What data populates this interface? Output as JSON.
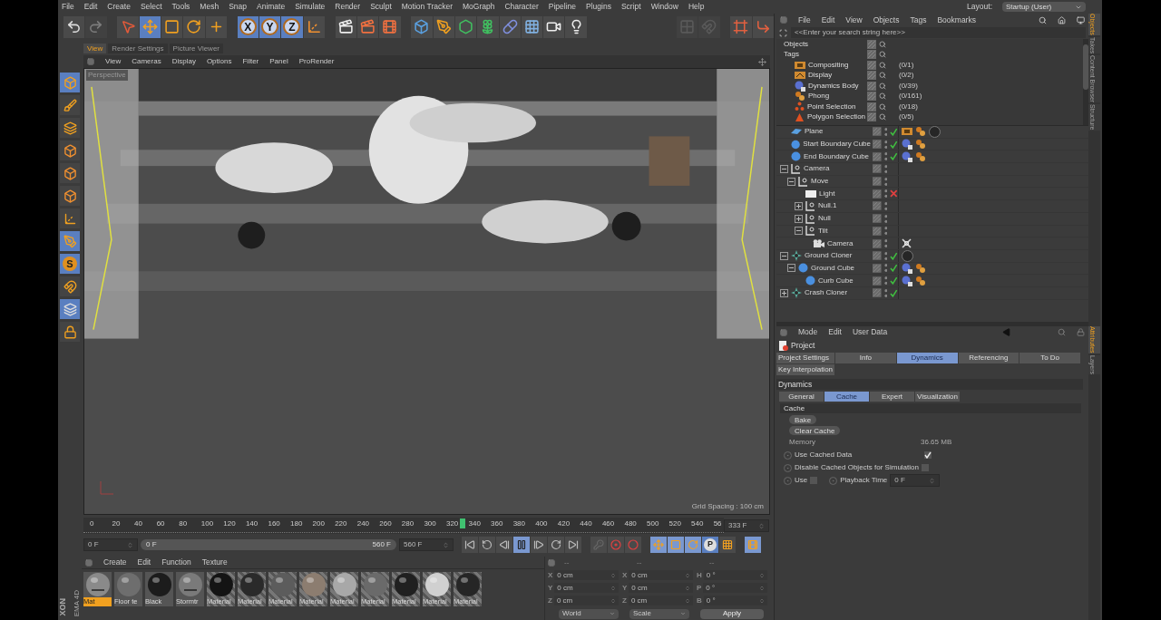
{
  "menu_bar": {
    "items": [
      "File",
      "Edit",
      "Create",
      "Select",
      "Tools",
      "Mesh",
      "Snap",
      "Animate",
      "Simulate",
      "Render",
      "Sculpt",
      "Motion Tracker",
      "MoGraph",
      "Character",
      "Pipeline",
      "Plugins",
      "Script",
      "Window",
      "Help"
    ],
    "layout_label": "Layout:",
    "layout_value": "Startup (User)"
  },
  "toolbar": [
    {
      "kind": "undo",
      "selected": false,
      "disabled": false
    },
    {
      "kind": "redo",
      "selected": false,
      "disabled": true
    },
    {
      "kind": "live-select",
      "selected": false,
      "disabled": false
    },
    {
      "kind": "move",
      "selected": true,
      "disabled": false
    },
    {
      "kind": "scale",
      "selected": false,
      "disabled": false
    },
    {
      "kind": "rotate",
      "selected": false,
      "disabled": false
    },
    {
      "kind": "add",
      "selected": false,
      "disabled": false
    },
    {
      "kind": "axis",
      "label": "X",
      "selected": true,
      "disabled": false
    },
    {
      "kind": "axis",
      "label": "Y",
      "selected": true,
      "disabled": false
    },
    {
      "kind": "axis",
      "label": "Z",
      "selected": true,
      "disabled": false
    },
    {
      "kind": "coordinates",
      "selected": false,
      "disabled": false
    },
    {
      "kind": "render-view",
      "selected": false,
      "disabled": false
    },
    {
      "kind": "render",
      "selected": false,
      "disabled": false
    },
    {
      "kind": "render-settings",
      "selected": false,
      "disabled": false
    },
    {
      "kind": "cube",
      "selected": false,
      "disabled": false
    },
    {
      "kind": "pen",
      "selected": false,
      "disabled": false
    },
    {
      "kind": "subdivision",
      "selected": false,
      "disabled": false
    },
    {
      "kind": "cloner",
      "selected": false,
      "disabled": false
    },
    {
      "kind": "deformer",
      "selected": false,
      "disabled": false
    },
    {
      "kind": "floor",
      "selected": false,
      "disabled": false
    },
    {
      "kind": "camera",
      "selected": false,
      "disabled": false
    },
    {
      "kind": "light",
      "selected": false,
      "disabled": false
    },
    {
      "kind": "workplane",
      "selected": false,
      "disabled": true
    },
    {
      "kind": "snap",
      "selected": false,
      "disabled": true
    },
    {
      "kind": "viewport-solo",
      "selected": false,
      "disabled": false
    },
    {
      "kind": "axis-lock",
      "selected": false,
      "disabled": false
    }
  ],
  "left_tools": [
    {
      "kind": "model",
      "selected": true
    },
    {
      "kind": "texture",
      "selected": false
    },
    {
      "kind": "workplane",
      "selected": false
    },
    {
      "kind": "points",
      "selected": false
    },
    {
      "kind": "edges",
      "selected": false
    },
    {
      "kind": "polygons",
      "selected": false
    },
    {
      "kind": "enable-axis",
      "selected": false
    },
    {
      "kind": "tweak",
      "selected": true
    },
    {
      "kind": "solo",
      "label": "S",
      "selected": true
    },
    {
      "kind": "snap",
      "selected": false
    },
    {
      "kind": "grid",
      "selected": true
    },
    {
      "kind": "grid-lock",
      "selected": false
    }
  ],
  "viewport": {
    "tabs": [
      {
        "label": "View",
        "selected": true
      },
      {
        "label": "Render Settings",
        "selected": false
      },
      {
        "label": "Picture Viewer",
        "selected": false
      }
    ],
    "menu": [
      "View",
      "Cameras",
      "Display",
      "Options",
      "Filter",
      "Panel",
      "ProRender"
    ],
    "camera_label": "Perspective",
    "grid_spacing": "Grid Spacing : 100 cm"
  },
  "timeline": {
    "ticks": [
      "0",
      "20",
      "40",
      "60",
      "80",
      "100",
      "120",
      "140",
      "160",
      "180",
      "200",
      "220",
      "240",
      "260",
      "280",
      "300",
      "320",
      "340",
      "360",
      "380",
      "400",
      "420",
      "440",
      "460",
      "480",
      "500",
      "520",
      "540",
      "56"
    ],
    "current": {
      "level": 0.595
    },
    "frame": "333 F"
  },
  "transport": {
    "start": "0 F",
    "range": {
      "start": "0 F",
      "end": "560 F"
    },
    "end": "560 F",
    "controls": [
      {
        "kind": "first",
        "selected": false
      },
      {
        "kind": "prev-key",
        "selected": false
      },
      {
        "kind": "prev-frame",
        "selected": false
      },
      {
        "kind": "pause",
        "selected": true
      },
      {
        "kind": "next-frame",
        "selected": false
      },
      {
        "kind": "next-key",
        "selected": false
      },
      {
        "kind": "last",
        "selected": false
      },
      {
        "kind": "keyframe-off",
        "selected": false
      },
      {
        "kind": "record",
        "selected": false
      },
      {
        "kind": "autokey",
        "selected": false
      },
      {
        "kind": "key-move",
        "selected": true
      },
      {
        "kind": "key-scale",
        "selected": true
      },
      {
        "kind": "key-rotate",
        "selected": true
      },
      {
        "kind": "key-param",
        "label": "P",
        "selected": true
      },
      {
        "kind": "key-points",
        "selected": false
      },
      {
        "kind": "timeline",
        "selected": true
      }
    ]
  },
  "materials": {
    "menu": [
      "Create",
      "Edit",
      "Function",
      "Texture"
    ],
    "items": [
      {
        "name": "Mat",
        "selected": true,
        "color": "#8a8a8a",
        "kind": "picture"
      },
      {
        "name": "Floor te",
        "selected": false,
        "color": "#6e6e6e",
        "kind": "plain"
      },
      {
        "name": "Black",
        "selected": false,
        "color": "#1c1c1c",
        "kind": "plain"
      },
      {
        "name": "Stormtr",
        "selected": false,
        "color": "#7a7a7a",
        "kind": "picture"
      },
      {
        "name": "Material",
        "selected": false,
        "color": "#141414",
        "kind": "unused"
      },
      {
        "name": "Material",
        "selected": false,
        "color": "#2a2a2a",
        "kind": "unused"
      },
      {
        "name": "Material",
        "selected": false,
        "color": "#5c5c5c",
        "kind": "unused"
      },
      {
        "name": "Material",
        "selected": false,
        "color": "#8c7d70",
        "kind": "unused"
      },
      {
        "name": "Material",
        "selected": false,
        "color": "#a8a8a8",
        "kind": "unused"
      },
      {
        "name": "Material",
        "selected": false,
        "color": "#6a6a6a",
        "kind": "unused"
      },
      {
        "name": "Material",
        "selected": false,
        "color": "#202020",
        "kind": "unused"
      },
      {
        "name": "Material",
        "selected": false,
        "color": "#d0d0d0",
        "kind": "unused"
      },
      {
        "name": "Material",
        "selected": false,
        "color": "#262626",
        "kind": "unused"
      }
    ]
  },
  "coordinates": {
    "columns": [
      {
        "header": "--",
        "fields": [
          {
            "label": "X",
            "value": "0 cm"
          },
          {
            "label": "Y",
            "value": "0 cm"
          },
          {
            "label": "Z",
            "value": "0 cm"
          }
        ]
      },
      {
        "header": "--",
        "fields": [
          {
            "label": "X",
            "value": "0 cm"
          },
          {
            "label": "Y",
            "value": "0 cm"
          },
          {
            "label": "Z",
            "value": "0 cm"
          }
        ]
      },
      {
        "header": "--",
        "fields": [
          {
            "label": "H",
            "value": "0 °"
          },
          {
            "label": "P",
            "value": "0 °"
          },
          {
            "label": "B",
            "value": "0 °"
          }
        ]
      }
    ],
    "dropdowns": [
      "World",
      "Scale"
    ],
    "apply": "Apply"
  },
  "logo": [
    "XON",
    "EMA 4D"
  ],
  "object_manager": {
    "menu": [
      "File",
      "Edit",
      "View",
      "Objects",
      "Tags",
      "Bookmarks"
    ],
    "search": {
      "placeholder": "<<Enter your search string here>>"
    },
    "filters": [
      {
        "label": "Objects"
      },
      {
        "label": "Tags",
        "children": [
          {
            "label": "Compositing",
            "kind": "compositing",
            "count": "(0/1)"
          },
          {
            "label": "Display",
            "kind": "display",
            "count": "(0/2)"
          },
          {
            "label": "Dynamics Body",
            "kind": "dynamics",
            "count": "(0/39)"
          },
          {
            "label": "Phong",
            "kind": "phong",
            "count": "(0/161)"
          },
          {
            "label": "Point Selection",
            "kind": "point-selection",
            "count": "(0/18)"
          },
          {
            "label": "Polygon Selection",
            "kind": "polygon-selection",
            "count": "(0/5)"
          }
        ]
      }
    ],
    "objects": [
      {
        "name": "Plane",
        "kind": "plane",
        "enabled": true,
        "tags": [
          {
            "kind": "compositing"
          },
          {
            "kind": "phong"
          },
          {
            "kind": "material"
          }
        ]
      },
      {
        "name": "Start Boundary Cube",
        "kind": "cube",
        "enabled": true,
        "tags": [
          {
            "kind": "dynamics"
          },
          {
            "kind": "phong"
          }
        ]
      },
      {
        "name": "End Boundary Cube",
        "kind": "cube",
        "enabled": true,
        "tags": [
          {
            "kind": "dynamics"
          },
          {
            "kind": "phong"
          }
        ]
      },
      {
        "name": "Camera",
        "kind": "null",
        "expanded": true,
        "children": [
          {
            "name": "Move",
            "kind": "null",
            "expanded": true,
            "children": [
              {
                "name": "Light",
                "kind": "light",
                "enabled": false
              },
              {
                "name": "Null.1",
                "kind": "null",
                "expanded": false
              },
              {
                "name": "Null",
                "kind": "null",
                "expanded": false
              },
              {
                "name": "Tilt",
                "kind": "null",
                "expanded": true,
                "children": [
                  {
                    "name": "Camera",
                    "kind": "camera",
                    "tags": [
                      {
                        "kind": "target"
                      }
                    ]
                  }
                ]
              }
            ]
          }
        ]
      },
      {
        "name": "Ground Cloner",
        "kind": "cloner",
        "enabled": true,
        "expanded": true,
        "tags": [
          {
            "kind": "material"
          }
        ],
        "children": [
          {
            "name": "Ground Cube",
            "kind": "cube",
            "enabled": true,
            "expanded": true,
            "tags": [
              {
                "kind": "dynamics"
              },
              {
                "kind": "phong"
              }
            ],
            "children": [
              {
                "name": "Curb Cube",
                "kind": "cube",
                "enabled": true,
                "tags": [
                  {
                    "kind": "dynamics"
                  },
                  {
                    "kind": "phong"
                  }
                ]
              }
            ]
          }
        ]
      },
      {
        "name": "Crash Cloner",
        "kind": "cloner",
        "enabled": true,
        "expanded": false
      }
    ]
  },
  "attributes": {
    "menu": [
      "Mode",
      "Edit",
      "User Data"
    ],
    "title": "Project",
    "tabs": [
      {
        "label": "Project Settings",
        "selected": false
      },
      {
        "label": "Info",
        "selected": false
      },
      {
        "label": "Dynamics",
        "selected": true
      },
      {
        "label": "Referencing",
        "selected": false
      },
      {
        "label": "To Do",
        "selected": false
      },
      {
        "label": "Key Interpolation",
        "selected": false
      }
    ],
    "section": "Dynamics",
    "subtabs": [
      {
        "label": "General",
        "selected": false
      },
      {
        "label": "Cache",
        "selected": true
      },
      {
        "label": "Expert",
        "selected": false
      },
      {
        "label": "Visualization",
        "selected": false
      }
    ],
    "group": "Cache",
    "buttons": [
      "Bake",
      "Clear Cache"
    ],
    "memory": {
      "label": "Memory",
      "value": "36.65 MB"
    },
    "options": [
      {
        "label": "Use Cached Data",
        "checked": true
      },
      {
        "label": "Disable Cached Objects for Simulation",
        "checked": false
      }
    ],
    "use": {
      "label": "Use",
      "checked": false
    },
    "playback_time": {
      "label": "Playback Time",
      "value": "0 F"
    }
  },
  "side_tabs_top": [
    {
      "label": "Objects",
      "selected": true
    },
    {
      "label": "Takes",
      "selected": false
    },
    {
      "label": "Content Browser",
      "selected": false
    },
    {
      "label": "Structure",
      "selected": false
    }
  ],
  "side_tabs_bottom": [
    {
      "label": "Attributes",
      "selected": true
    },
    {
      "label": "Layers",
      "selected": false
    }
  ]
}
